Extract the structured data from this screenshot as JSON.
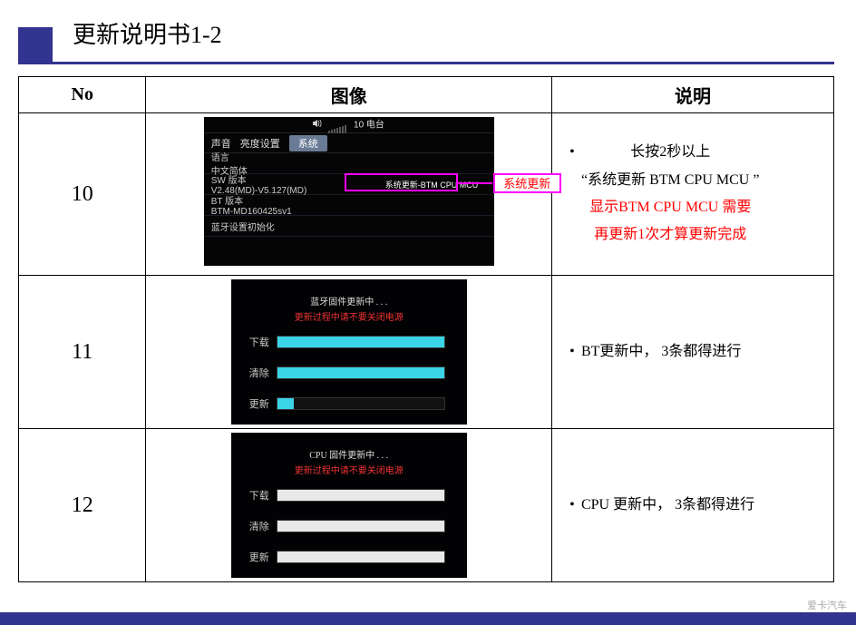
{
  "page": {
    "title": "更新说明书1-2",
    "footer_text": "爱卡汽车"
  },
  "headers": {
    "no": "No",
    "image": "图像",
    "desc": "说明"
  },
  "row10": {
    "no": "10",
    "top_text": "10 电台",
    "tabs": {
      "audio": "声音",
      "brightness": "亮度设置",
      "system": "系统"
    },
    "rows": {
      "lang_label": "语言",
      "lang_value": "中文简体",
      "sw_label": "SW 版本",
      "sw_value": "V2.48(MD)-V5.127(MD)",
      "update_button": "系统更新-BTM CPU MCU",
      "bt_label": "BT 版本",
      "bt_value": "BTM-MD160425sv1",
      "bt_init": "蓝牙设置初始化"
    },
    "callout": "系统更新",
    "desc": {
      "line1": "长按2秒以上",
      "line2a": "“",
      "line2b": "系统更新",
      "line2c": " BTM CPU MCU ”",
      "line3": "显示BTM CPU MCU 需要",
      "line4": "再更新1次才算更新完成"
    }
  },
  "row11": {
    "no": "11",
    "hdr": "蓝牙固件更新中 . . .",
    "hdr2": "更新过程中请不要关闭电源",
    "labels": {
      "download": "下载",
      "clear": "清除",
      "update": "更新"
    },
    "progress": {
      "download": 100,
      "clear": 100,
      "update": 10
    },
    "desc": "BT更新中， 3条都得进行"
  },
  "row12": {
    "no": "12",
    "hdr": "CPU 固件更新中 . . .",
    "hdr2": "更新过程中请不要关闭电源",
    "labels": {
      "download": "下载",
      "clear": "清除",
      "update": "更新"
    },
    "progress": {
      "download": 100,
      "clear": 100,
      "update": 100
    },
    "desc": "CPU  更新中， 3条都得进行"
  }
}
